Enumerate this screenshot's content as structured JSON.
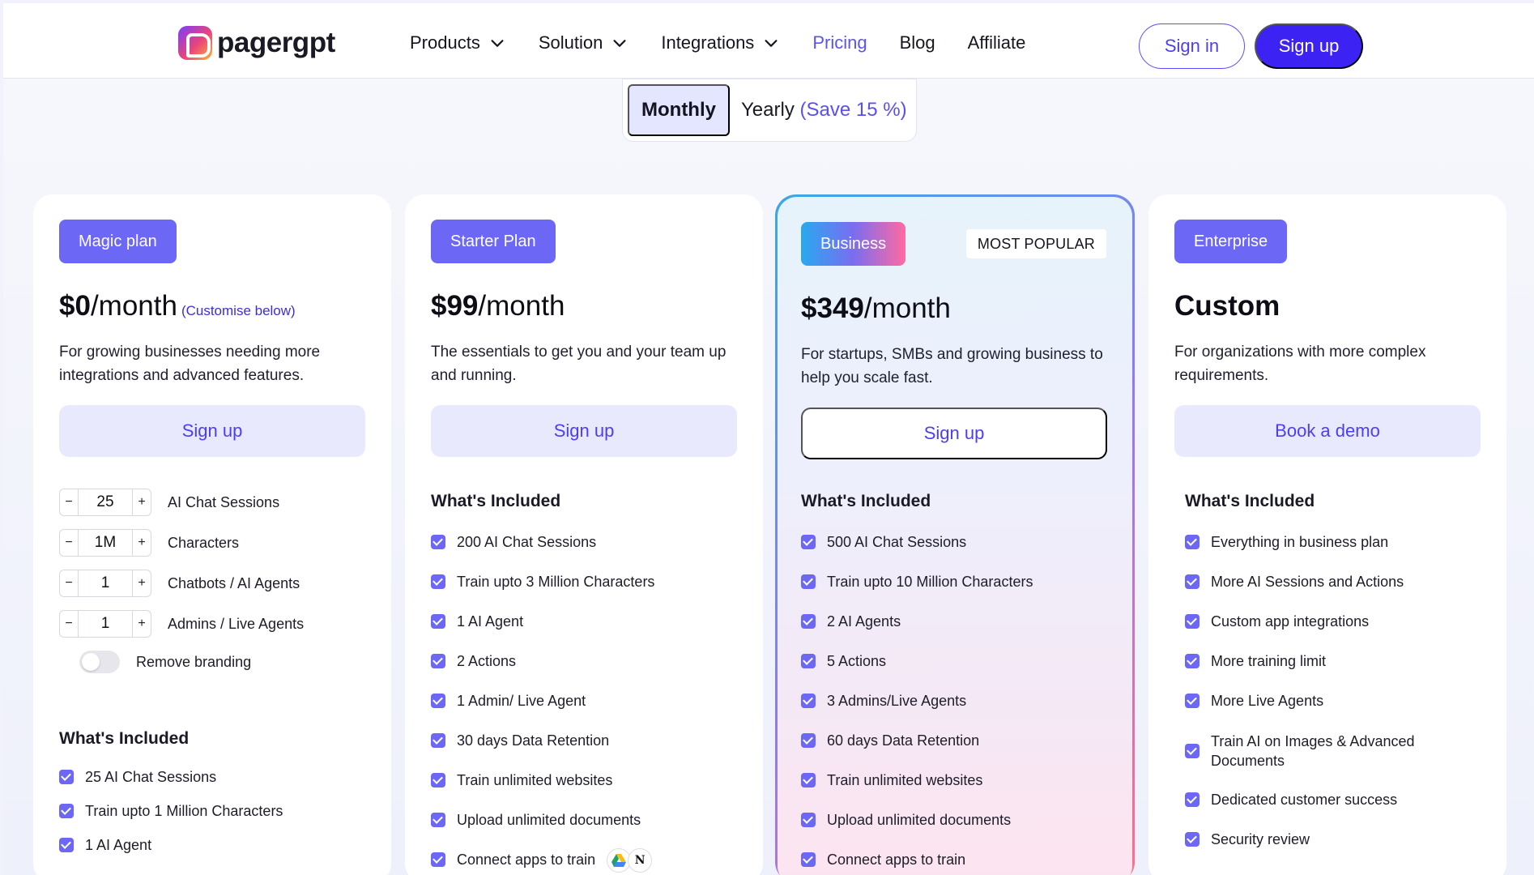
{
  "nav": {
    "logo_text": "pagergpt",
    "items": [
      {
        "label": "Products",
        "has_dropdown": true
      },
      {
        "label": "Solution",
        "has_dropdown": true
      },
      {
        "label": "Integrations",
        "has_dropdown": true
      },
      {
        "label": "Pricing",
        "active": true
      },
      {
        "label": "Blog"
      },
      {
        "label": "Affiliate"
      }
    ],
    "sign_in": "Sign in",
    "sign_up": "Sign up"
  },
  "billing": {
    "monthly": "Monthly",
    "yearly": "Yearly",
    "yearly_save": "(Save 15 %)"
  },
  "plans": [
    {
      "badge": "Magic plan",
      "price": "$0",
      "per": "/month",
      "customise": "(Customise below)",
      "description": "For growing businesses needing more integrations and advanced features.",
      "cta": "Sign up",
      "steppers": [
        {
          "value": "25",
          "label": "AI Chat Sessions"
        },
        {
          "value": "1M",
          "label": "Characters"
        },
        {
          "value": "1",
          "label": "Chatbots / AI Agents"
        },
        {
          "value": "1",
          "label": "Admins / Live Agents"
        }
      ],
      "toggle_label": "Remove branding",
      "included_title": "What's Included",
      "features": [
        "25 AI Chat Sessions",
        "Train upto 1 Million Characters",
        "1 AI Agent"
      ]
    },
    {
      "badge": "Starter Plan",
      "price": "$99",
      "per": "/month",
      "description": "The essentials to get you and your team up and running.",
      "cta": "Sign up",
      "included_title": "What's Included",
      "features": [
        "200 AI Chat Sessions",
        "Train upto 3 Million Characters",
        "1 AI Agent",
        "2 Actions",
        "1 Admin/ Live Agent",
        "30 days Data Retention",
        "Train unlimited websites",
        "Upload unlimited documents",
        "Connect apps to train"
      ]
    },
    {
      "badge": "Business",
      "popular": "MOST POPULAR",
      "price": "$349",
      "per": "/month",
      "description": "For startups, SMBs and growing business to help you scale fast.",
      "cta": "Sign up",
      "included_title": "What's Included",
      "features": [
        "500 AI Chat Sessions",
        "Train upto 10 Million Characters",
        "2 AI Agents",
        "5 Actions",
        "3 Admins/Live Agents",
        "60 days Data Retention",
        "Train unlimited websites",
        "Upload unlimited documents",
        "Connect apps to train"
      ]
    },
    {
      "badge": "Enterprise",
      "price": "Custom",
      "description": "For organizations with more complex requirements.",
      "cta": "Book a demo",
      "included_title": "What's Included",
      "features": [
        "Everything in business plan",
        "More AI Sessions and Actions",
        "Custom app integrations",
        "More training limit",
        "More Live Agents",
        "Train AI on Images & Advanced Documents",
        "Dedicated customer success",
        "Security review"
      ]
    }
  ],
  "colors": {
    "accent": "#3d22f4",
    "badge": "#6c67f5",
    "link": "#4d3ef4"
  }
}
